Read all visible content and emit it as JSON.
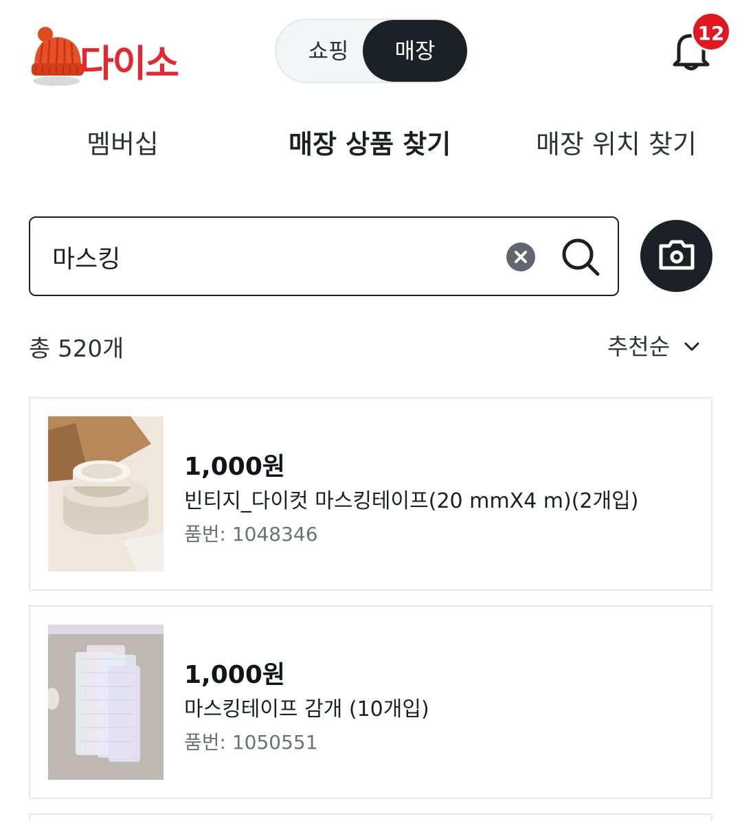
{
  "header": {
    "logo_text": "다이소",
    "toggle": {
      "shopping": "쇼핑",
      "store": "매장",
      "selected": "store"
    },
    "notification_count": "12"
  },
  "subnav": {
    "items": [
      {
        "label": "멤버십",
        "active": false
      },
      {
        "label": "매장 상품 찾기",
        "active": true
      },
      {
        "label": "매장 위치 찾기",
        "active": false
      }
    ]
  },
  "search": {
    "value": "마스킹",
    "placeholder": ""
  },
  "results": {
    "total_label": "총 520개",
    "sort_label": "추천순"
  },
  "products": [
    {
      "price": "1,000원",
      "name": "빈티지_다이컷 마스킹테이프(20 mmX4 m)(2개입)",
      "code": "품번: 1048346"
    },
    {
      "price": "1,000원",
      "name": "마스킹테이프 감개 (10개입)",
      "code": "품번: 1050551"
    }
  ],
  "colors": {
    "brand_red": "#e8262d",
    "dark": "#1c2128",
    "badge_red": "#e0171f"
  }
}
